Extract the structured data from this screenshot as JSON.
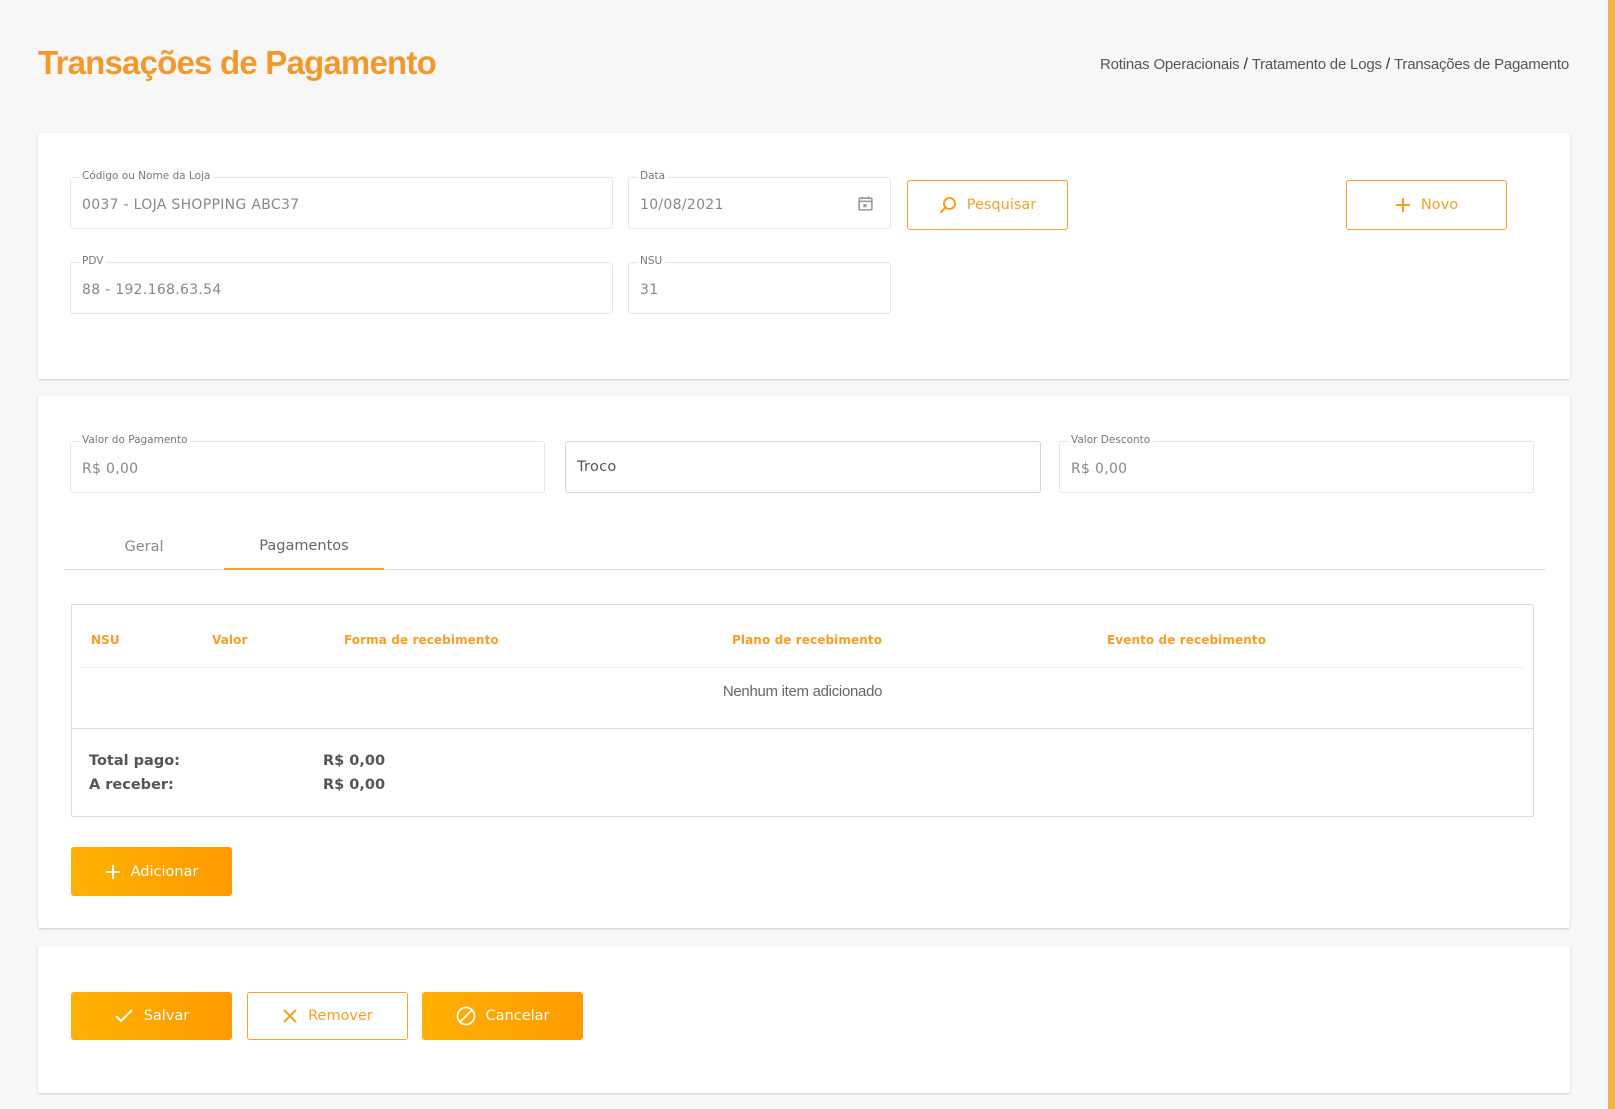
{
  "header": {
    "title": "Transações de Pagamento",
    "breadcrumb": [
      "Rotinas Operacionais",
      "Tratamento de Logs",
      "Transações de Pagamento"
    ],
    "breadcrumb_separator": "/"
  },
  "filters": {
    "loja": {
      "label": "Código ou Nome da Loja",
      "value": "0037 - LOJA SHOPPING ABC37"
    },
    "data": {
      "label": "Data",
      "value": "10/08/2021"
    },
    "pdv": {
      "label": "PDV",
      "value": "88 - 192.168.63.54"
    },
    "nsu": {
      "label": "NSU",
      "value": "31"
    },
    "search_button": "Pesquisar",
    "new_button": "Novo"
  },
  "payment": {
    "valor_pagamento": {
      "label": "Valor do Pagamento",
      "value": "R$ 0,00"
    },
    "troco": {
      "placeholder": "Troco"
    },
    "valor_desconto": {
      "label": "Valor Desconto",
      "value": "R$ 0,00"
    }
  },
  "tabs": [
    {
      "label": "Geral",
      "active": false
    },
    {
      "label": "Pagamentos",
      "active": true
    }
  ],
  "table": {
    "columns": [
      "NSU",
      "Valor",
      "Forma de recebimento",
      "Plano de recebimento",
      "Evento de recebimento"
    ],
    "rows": [],
    "empty_message": "Nenhum item adicionado",
    "totals": [
      {
        "label": "Total pago:",
        "value": "R$ 0,00"
      },
      {
        "label": "A receber:",
        "value": "R$ 0,00"
      }
    ]
  },
  "add_button": "Adicionar",
  "actions": {
    "save": "Salvar",
    "remove": "Remover",
    "cancel": "Cancelar"
  },
  "colors": {
    "accent": "#f2992e",
    "button_gradient_start": "#ffb100",
    "button_gradient_end": "#ff9a00",
    "table_header": "#f2a02a"
  },
  "icons": {
    "search": "search-icon",
    "plus": "plus-icon",
    "calendar": "calendar-icon",
    "check": "check-icon",
    "close": "close-icon",
    "cancel": "ban-icon"
  }
}
